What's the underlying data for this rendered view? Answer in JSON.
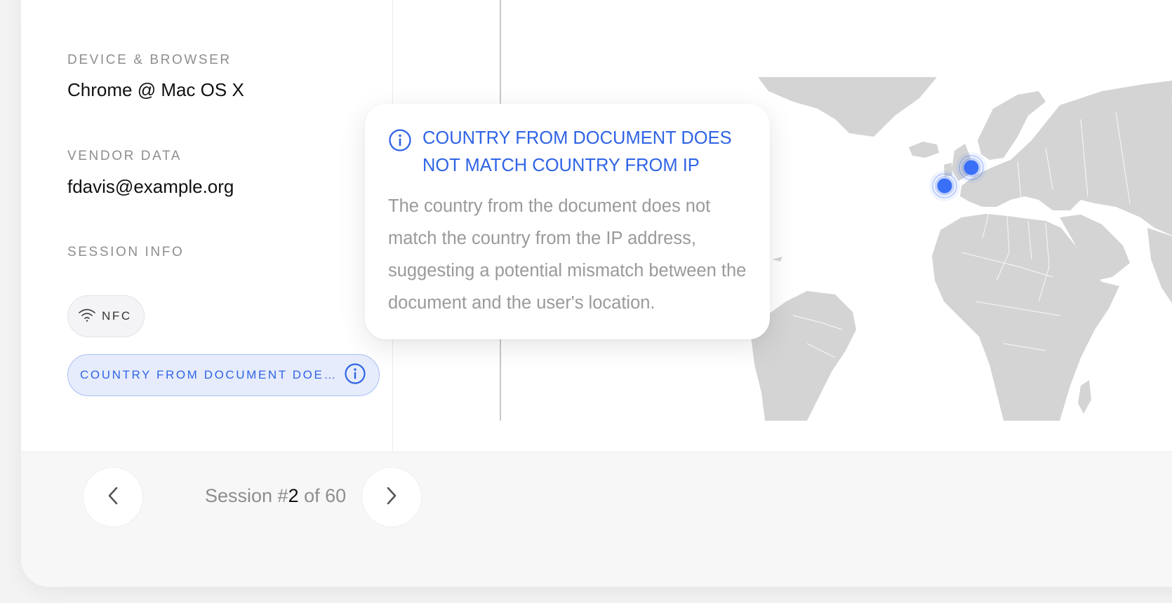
{
  "details": {
    "device_label": "DEVICE & BROWSER",
    "device_value": "Chrome @ Mac OS X",
    "vendor_label": "VENDOR DATA",
    "vendor_value": "fdavis@example.org",
    "session_label": "SESSION INFO"
  },
  "chips": {
    "nfc": "NFC",
    "warning": "COUNTRY FROM DOCUMENT DOES NOT MATCH COUNTRY FROM IP"
  },
  "tooltip": {
    "title": "COUNTRY FROM DOCUMENT DOES NOT MATCH COUNTRY FROM IP",
    "body": "The country from the document does not match the country from the IP address, suggesting a potential mismatch between the document and the user's location."
  },
  "pagination": {
    "prefix": "Session #",
    "current": "2",
    "suffix": " of 60"
  },
  "icons": {
    "nfc": "wifi-icon",
    "info": "info-icon",
    "prev": "chevron-left-icon",
    "next": "chevron-right-icon"
  },
  "colors": {
    "accent": "#2f64e6",
    "map_land": "#d4d4d4",
    "marker": "#3a6ff7"
  }
}
